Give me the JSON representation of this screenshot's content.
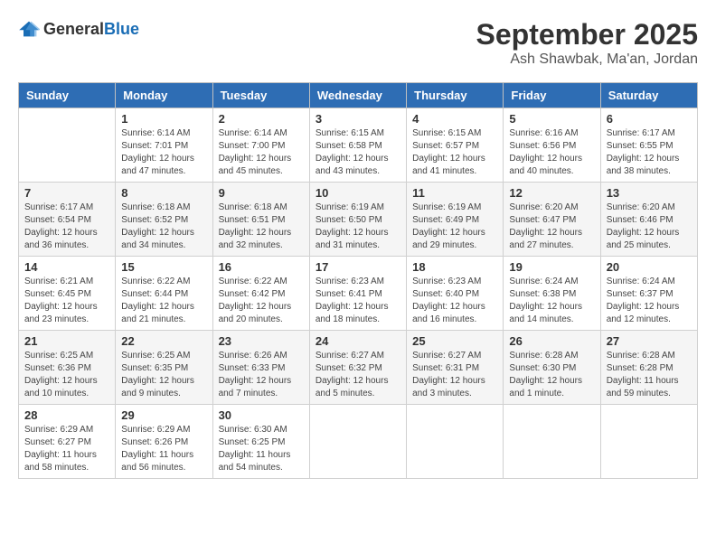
{
  "logo": {
    "general": "General",
    "blue": "Blue"
  },
  "title": "September 2025",
  "location": "Ash Shawbak, Ma'an, Jordan",
  "days_of_week": [
    "Sunday",
    "Monday",
    "Tuesday",
    "Wednesday",
    "Thursday",
    "Friday",
    "Saturday"
  ],
  "weeks": [
    [
      {
        "day": "",
        "info": ""
      },
      {
        "day": "1",
        "info": "Sunrise: 6:14 AM\nSunset: 7:01 PM\nDaylight: 12 hours\nand 47 minutes."
      },
      {
        "day": "2",
        "info": "Sunrise: 6:14 AM\nSunset: 7:00 PM\nDaylight: 12 hours\nand 45 minutes."
      },
      {
        "day": "3",
        "info": "Sunrise: 6:15 AM\nSunset: 6:58 PM\nDaylight: 12 hours\nand 43 minutes."
      },
      {
        "day": "4",
        "info": "Sunrise: 6:15 AM\nSunset: 6:57 PM\nDaylight: 12 hours\nand 41 minutes."
      },
      {
        "day": "5",
        "info": "Sunrise: 6:16 AM\nSunset: 6:56 PM\nDaylight: 12 hours\nand 40 minutes."
      },
      {
        "day": "6",
        "info": "Sunrise: 6:17 AM\nSunset: 6:55 PM\nDaylight: 12 hours\nand 38 minutes."
      }
    ],
    [
      {
        "day": "7",
        "info": "Sunrise: 6:17 AM\nSunset: 6:54 PM\nDaylight: 12 hours\nand 36 minutes."
      },
      {
        "day": "8",
        "info": "Sunrise: 6:18 AM\nSunset: 6:52 PM\nDaylight: 12 hours\nand 34 minutes."
      },
      {
        "day": "9",
        "info": "Sunrise: 6:18 AM\nSunset: 6:51 PM\nDaylight: 12 hours\nand 32 minutes."
      },
      {
        "day": "10",
        "info": "Sunrise: 6:19 AM\nSunset: 6:50 PM\nDaylight: 12 hours\nand 31 minutes."
      },
      {
        "day": "11",
        "info": "Sunrise: 6:19 AM\nSunset: 6:49 PM\nDaylight: 12 hours\nand 29 minutes."
      },
      {
        "day": "12",
        "info": "Sunrise: 6:20 AM\nSunset: 6:47 PM\nDaylight: 12 hours\nand 27 minutes."
      },
      {
        "day": "13",
        "info": "Sunrise: 6:20 AM\nSunset: 6:46 PM\nDaylight: 12 hours\nand 25 minutes."
      }
    ],
    [
      {
        "day": "14",
        "info": "Sunrise: 6:21 AM\nSunset: 6:45 PM\nDaylight: 12 hours\nand 23 minutes."
      },
      {
        "day": "15",
        "info": "Sunrise: 6:22 AM\nSunset: 6:44 PM\nDaylight: 12 hours\nand 21 minutes."
      },
      {
        "day": "16",
        "info": "Sunrise: 6:22 AM\nSunset: 6:42 PM\nDaylight: 12 hours\nand 20 minutes."
      },
      {
        "day": "17",
        "info": "Sunrise: 6:23 AM\nSunset: 6:41 PM\nDaylight: 12 hours\nand 18 minutes."
      },
      {
        "day": "18",
        "info": "Sunrise: 6:23 AM\nSunset: 6:40 PM\nDaylight: 12 hours\nand 16 minutes."
      },
      {
        "day": "19",
        "info": "Sunrise: 6:24 AM\nSunset: 6:38 PM\nDaylight: 12 hours\nand 14 minutes."
      },
      {
        "day": "20",
        "info": "Sunrise: 6:24 AM\nSunset: 6:37 PM\nDaylight: 12 hours\nand 12 minutes."
      }
    ],
    [
      {
        "day": "21",
        "info": "Sunrise: 6:25 AM\nSunset: 6:36 PM\nDaylight: 12 hours\nand 10 minutes."
      },
      {
        "day": "22",
        "info": "Sunrise: 6:25 AM\nSunset: 6:35 PM\nDaylight: 12 hours\nand 9 minutes."
      },
      {
        "day": "23",
        "info": "Sunrise: 6:26 AM\nSunset: 6:33 PM\nDaylight: 12 hours\nand 7 minutes."
      },
      {
        "day": "24",
        "info": "Sunrise: 6:27 AM\nSunset: 6:32 PM\nDaylight: 12 hours\nand 5 minutes."
      },
      {
        "day": "25",
        "info": "Sunrise: 6:27 AM\nSunset: 6:31 PM\nDaylight: 12 hours\nand 3 minutes."
      },
      {
        "day": "26",
        "info": "Sunrise: 6:28 AM\nSunset: 6:30 PM\nDaylight: 12 hours\nand 1 minute."
      },
      {
        "day": "27",
        "info": "Sunrise: 6:28 AM\nSunset: 6:28 PM\nDaylight: 11 hours\nand 59 minutes."
      }
    ],
    [
      {
        "day": "28",
        "info": "Sunrise: 6:29 AM\nSunset: 6:27 PM\nDaylight: 11 hours\nand 58 minutes."
      },
      {
        "day": "29",
        "info": "Sunrise: 6:29 AM\nSunset: 6:26 PM\nDaylight: 11 hours\nand 56 minutes."
      },
      {
        "day": "30",
        "info": "Sunrise: 6:30 AM\nSunset: 6:25 PM\nDaylight: 11 hours\nand 54 minutes."
      },
      {
        "day": "",
        "info": ""
      },
      {
        "day": "",
        "info": ""
      },
      {
        "day": "",
        "info": ""
      },
      {
        "day": "",
        "info": ""
      }
    ]
  ]
}
